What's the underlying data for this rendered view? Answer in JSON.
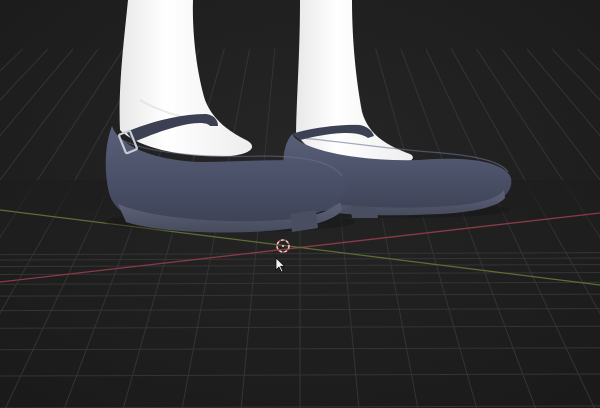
{
  "viewport": {
    "background_color": "#1d1d1d",
    "grid_color": "#343434",
    "x_axis_color": "#8a3a48",
    "y_axis_color": "#6b7a3a",
    "shoe_color": "#494f66",
    "sock_color": "#f4f4f4"
  },
  "icons": {
    "origin": "3d-cursor-icon",
    "pointer": "mouse-pointer-icon"
  }
}
